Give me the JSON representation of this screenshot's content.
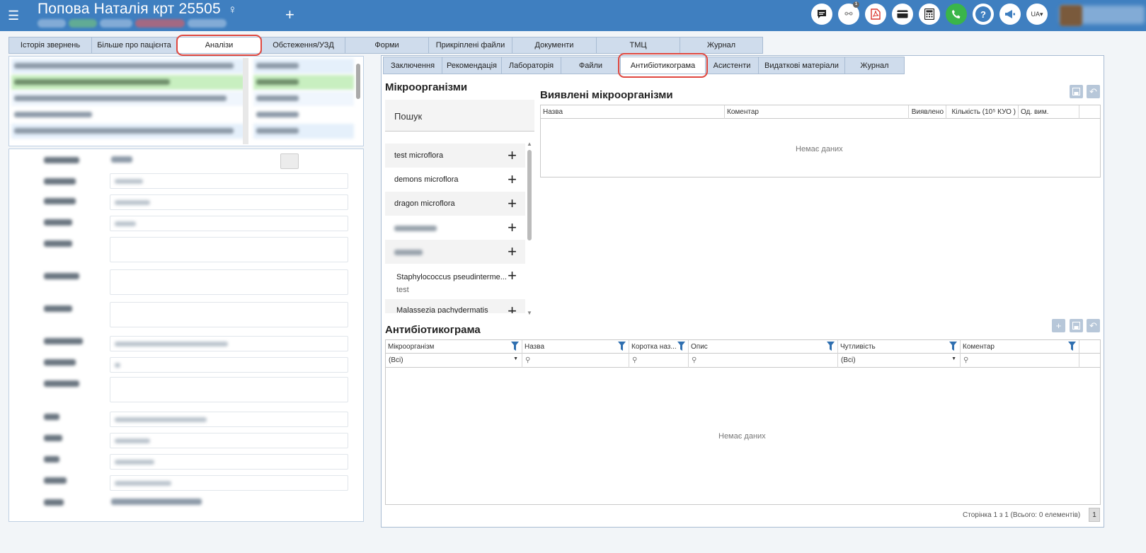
{
  "header": {
    "menu_icon": "hamburger-icon",
    "patient_name": "Попова Наталія крт 25505",
    "gender_icon": "♀",
    "add_tab": "+",
    "language": "UA▾",
    "icons": [
      "chat-icon",
      "notification-icon",
      "pdf-icon",
      "card-icon",
      "calculator-icon",
      "phone-icon",
      "help-icon",
      "megaphone-icon"
    ],
    "notification_count": "1"
  },
  "main_tabs": [
    {
      "label": "Історія звернень"
    },
    {
      "label": "Більше про пацієнта"
    },
    {
      "label": "Аналізи"
    },
    {
      "label": "Обстеження/УЗД"
    },
    {
      "label": "Форми"
    },
    {
      "label": "Прикріплені файли"
    },
    {
      "label": "Документи"
    },
    {
      "label": "ТМЦ"
    },
    {
      "label": "Журнал"
    }
  ],
  "sub_tabs": [
    {
      "label": "Заключення"
    },
    {
      "label": "Рекомендація"
    },
    {
      "label": "Лабораторія"
    },
    {
      "label": "Файли"
    },
    {
      "label": "Антибіотикограма"
    },
    {
      "label": "Асистенти"
    },
    {
      "label": "Видаткові матеріали"
    },
    {
      "label": "Журнал"
    }
  ],
  "microorganisms": {
    "title": "Мікроорганізми",
    "search_label": "Пошук",
    "items": [
      {
        "name": "test microflora",
        "sub": ""
      },
      {
        "name": "demons microflora",
        "sub": ""
      },
      {
        "name": "dragon microflora",
        "sub": ""
      },
      {
        "name": "",
        "sub": ""
      },
      {
        "name": "",
        "sub": ""
      },
      {
        "name": "Staphylococcus pseudinterme...",
        "sub": "test"
      },
      {
        "name": "Malassezia pachydermatis",
        "sub": ""
      }
    ],
    "add_icon": "+"
  },
  "detected": {
    "title": "Виявлені мікроорганізми",
    "columns": [
      "Назва",
      "Коментар",
      "Виявлено",
      "Кількість (10⁵ КУО )",
      "Од. вим."
    ],
    "empty_text": "Немає даних"
  },
  "antibiogram": {
    "title": "Антибіотикограма",
    "columns": [
      "Мікроорганізм",
      "Назва",
      "Коротка наз...",
      "Опис",
      "Чутливість",
      "Коментар"
    ],
    "filter_microorganism": "(Всі)",
    "filter_sensitivity": "(Всі)",
    "empty_text": "Немає даних",
    "pager_text": "Сторінка 1 з 1 (Всього: 0 елементів)",
    "page_number": "1"
  },
  "colors": {
    "topbar": "#3f7fc0",
    "tab": "#cfdcec",
    "highlight": "#e0473e",
    "green_row": "#c8efc0",
    "blue_row": "#e5f0fb"
  }
}
